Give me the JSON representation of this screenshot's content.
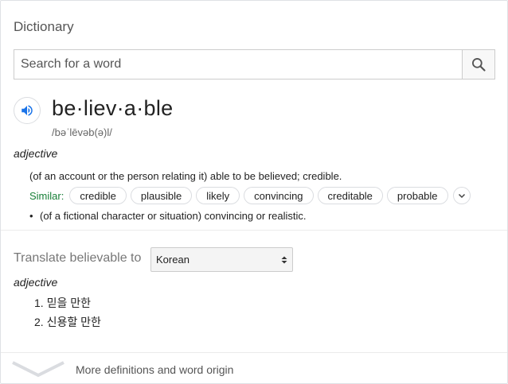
{
  "dictionary": {
    "title": "Dictionary",
    "search": {
      "placeholder": "Search for a word",
      "value": ""
    },
    "entry": {
      "headword": "be·liev·a·ble",
      "phonetic": "/bəˈlēvəb(ə)l/",
      "part_of_speech": "adjective",
      "definitions": [
        "(of an account or the person relating it) able to be believed; credible.",
        "(of a fictional character or situation) convincing or realistic."
      ],
      "similar_label": "Similar:",
      "similar": [
        "credible",
        "plausible",
        "likely",
        "convincing",
        "creditable",
        "probable"
      ]
    },
    "translate": {
      "label": "Translate believable to",
      "language": "Korean",
      "part_of_speech": "adjective",
      "items": [
        "1. 믿을 만한",
        "2. 신용할 만한"
      ]
    },
    "footer": {
      "more_label": "More definitions and word origin"
    }
  },
  "icons": {
    "search": "search-icon",
    "speaker": "speaker-icon",
    "expand": "chevron-down-icon",
    "select": "updown-arrows-icon",
    "footer": "chevron-down-icon"
  },
  "colors": {
    "accent": "#1a73e8",
    "similar_label": "#188038",
    "border": "#dadce0"
  }
}
